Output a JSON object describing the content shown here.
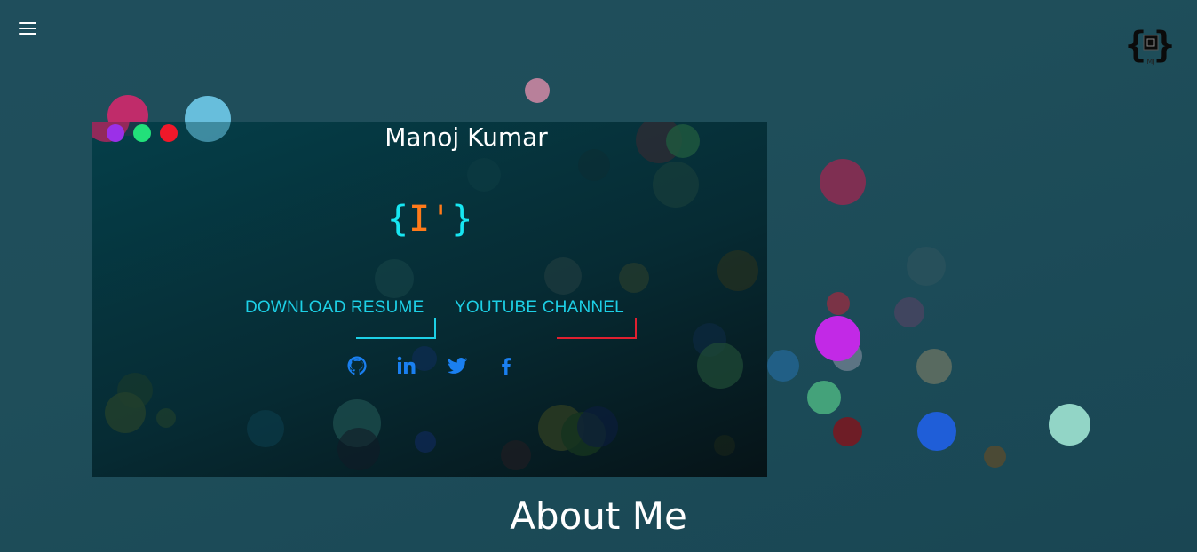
{
  "header": {
    "menu_icon": "hamburger-menu-icon",
    "logo_icon": "mj-brace-logo-icon",
    "logo_text": "MJ"
  },
  "hero": {
    "name": "Manoj Kumar",
    "window_dots": [
      "#9b30e8",
      "#22e07a",
      "#f0182a"
    ],
    "code_logo": {
      "open_brace": "{",
      "cursor": "I'",
      "close_brace": "}"
    },
    "buttons": {
      "download_resume": "DOWNLOAD RESUME",
      "youtube_channel": "YOUTUBE CHANNEL"
    },
    "social": [
      {
        "name": "github-icon"
      },
      {
        "name": "linkedin-icon"
      },
      {
        "name": "twitter-icon"
      },
      {
        "name": "facebook-icon"
      }
    ]
  },
  "sections": {
    "about_title": "About Me"
  },
  "colors": {
    "accent_cyan": "#1dd0e6",
    "accent_red": "#e02030",
    "brace": "#17e6f2",
    "cursor": "#ff7a1a",
    "social_blue": "#1a7ff0"
  }
}
